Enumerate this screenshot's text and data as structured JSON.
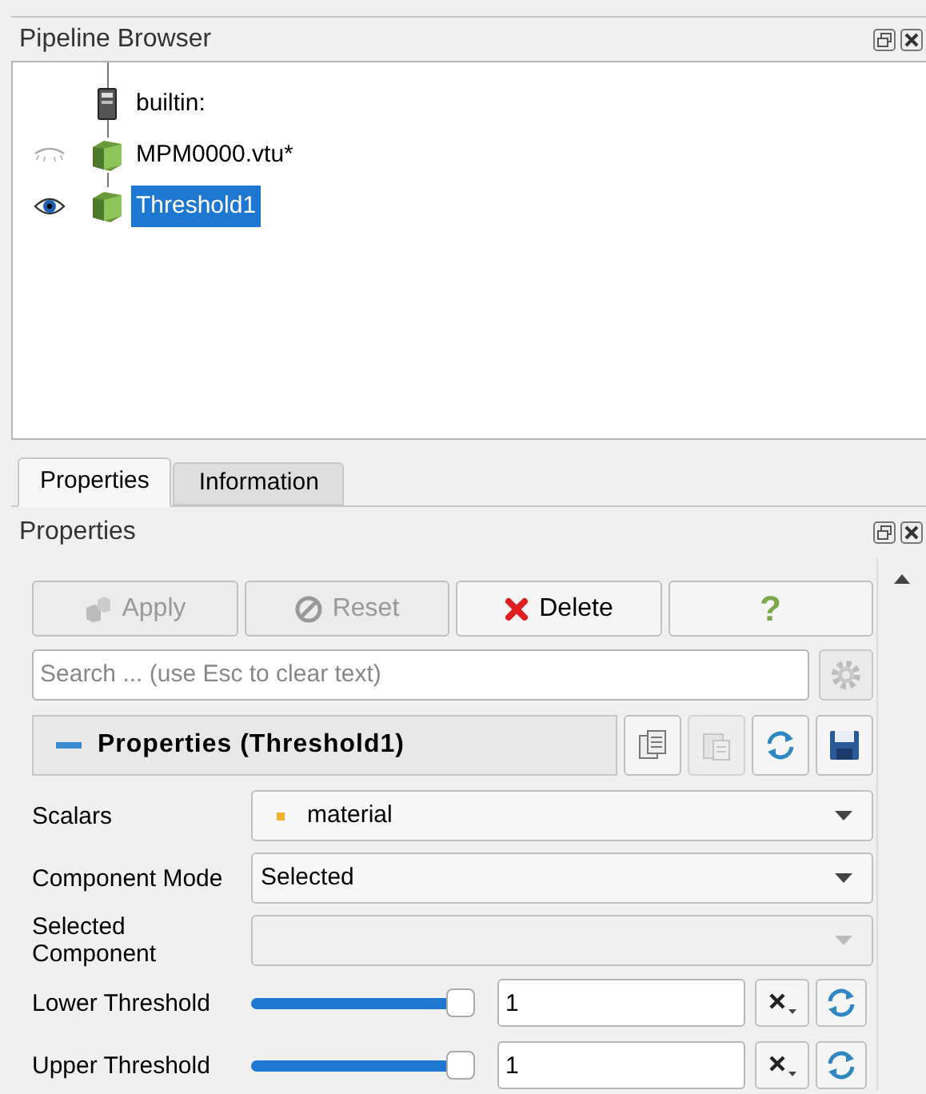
{
  "pipeline_browser": {
    "title": "Pipeline Browser",
    "items": [
      {
        "label": "builtin:",
        "kind": "server",
        "selected": false
      },
      {
        "label": "MPM0000.vtu*",
        "kind": "dataset",
        "visible": false,
        "selected": false
      },
      {
        "label": "Threshold1",
        "kind": "dataset",
        "visible": true,
        "selected": true
      }
    ]
  },
  "tabs": [
    {
      "label": "Properties",
      "selected": true
    },
    {
      "label": "Information",
      "selected": false
    }
  ],
  "properties_panel": {
    "title": "Properties",
    "buttons": [
      {
        "kind": "apply",
        "label": "Apply",
        "disabled": true
      },
      {
        "kind": "reset",
        "label": "Reset",
        "disabled": true
      },
      {
        "kind": "delete",
        "label": "Delete",
        "disabled": false
      },
      {
        "kind": "help",
        "label": "?"
      }
    ],
    "search": {
      "placeholder": "Search ... (use Esc to clear text)"
    },
    "section": {
      "title": "Properties (Threshold1)",
      "expanded": true,
      "tools": [
        {
          "kind": "copy",
          "disabled": false
        },
        {
          "kind": "paste",
          "disabled": true
        },
        {
          "kind": "refresh",
          "disabled": false
        },
        {
          "kind": "save",
          "disabled": false
        }
      ]
    },
    "rows": [
      {
        "kind": "dropdown",
        "label": "Scalars",
        "value": "material",
        "color": "#f0b030",
        "disabled": false
      },
      {
        "kind": "dropdown",
        "label": "Component Mode",
        "value": "Selected",
        "disabled": false
      },
      {
        "kind": "dropdown",
        "label": "Selected Component",
        "disabled": true
      },
      {
        "kind": "slider",
        "label": "Lower Threshold",
        "level": 1,
        "value": "1"
      },
      {
        "kind": "slider",
        "label": "Upper Threshold",
        "level": 1,
        "value": "1"
      }
    ]
  }
}
